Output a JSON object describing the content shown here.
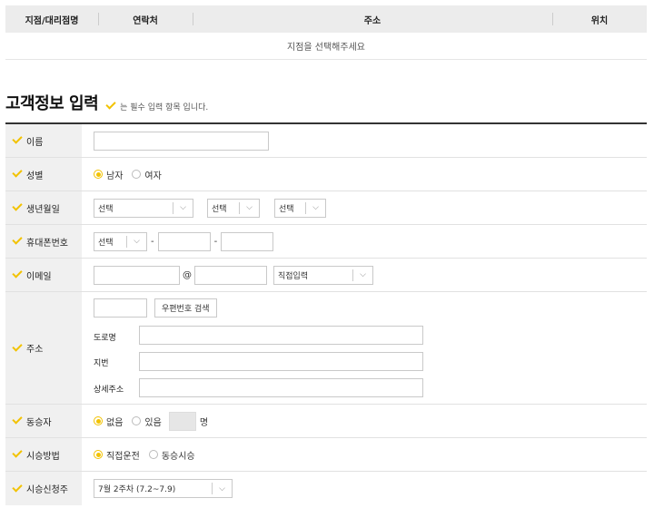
{
  "branch_table": {
    "columns": [
      "지점/대리점명",
      "연락처",
      "주소",
      "위치"
    ],
    "empty_message": "지점을 선택해주세요"
  },
  "title": "고객정보 입력",
  "required_note": "는 필수 입력 항목 입니다.",
  "colors": {
    "accent": "#f2c200",
    "label_bg": "#f0f0f0",
    "header_bg": "#ececec"
  },
  "fields": {
    "name": {
      "label": "이름",
      "value": ""
    },
    "gender": {
      "label": "성별",
      "options": [
        "남자",
        "여자"
      ],
      "selected": "남자"
    },
    "birth": {
      "label": "생년월일",
      "year": "선택",
      "month": "선택",
      "day": "선택"
    },
    "phone": {
      "label": "휴대폰번호",
      "prefix": "선택",
      "dash": "-"
    },
    "email": {
      "label": "이메일",
      "at": "@",
      "domain": "직접입력"
    },
    "address": {
      "label": "주소",
      "search_button": "우편번호 검색",
      "road_label": "도로명",
      "lot_label": "지번",
      "detail_label": "상세주소"
    },
    "companion": {
      "label": "동승자",
      "options": [
        "없음",
        "있음"
      ],
      "selected": "없음",
      "unit": "명"
    },
    "test_method": {
      "label": "시승방법",
      "options": [
        "직접운전",
        "동승시승"
      ],
      "selected": "직접운전"
    },
    "test_week": {
      "label": "시승신청주",
      "value": "7월 2주차 (7.2~7.9)"
    }
  }
}
